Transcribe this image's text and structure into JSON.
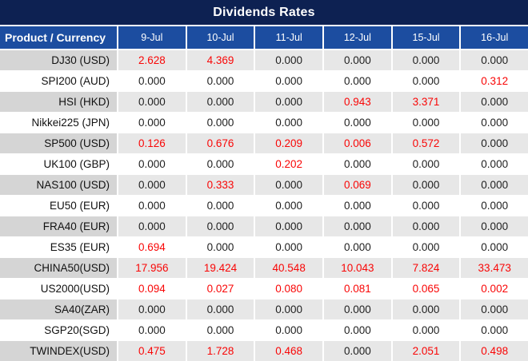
{
  "colors": {
    "title_bar_bg": "#0D2152",
    "header_bg": "#1C4DA0",
    "row_alt_label_bg": "#D5D5D5",
    "row_alt_value_bg": "#E7E7E7",
    "row_bg": "#FFFFFF",
    "highlight_value": "#F90606",
    "normal_value": "#1F1F1F",
    "header_text": "#FFFFFF"
  },
  "chart_data": {
    "type": "table",
    "title": "Dividends Rates",
    "corner_label": "Product / Currency",
    "columns": [
      "9-Jul",
      "10-Jul",
      "11-Jul",
      "12-Jul",
      "15-Jul",
      "16-Jul"
    ],
    "rows": [
      {
        "product": "DJ30 (USD)",
        "values": [
          "2.628",
          "4.369",
          "0.000",
          "0.000",
          "0.000",
          "0.000"
        ]
      },
      {
        "product": "SPI200 (AUD)",
        "values": [
          "0.000",
          "0.000",
          "0.000",
          "0.000",
          "0.000",
          "0.312"
        ]
      },
      {
        "product": "HSI (HKD)",
        "values": [
          "0.000",
          "0.000",
          "0.000",
          "0.943",
          "3.371",
          "0.000"
        ]
      },
      {
        "product": "Nikkei225 (JPN)",
        "values": [
          "0.000",
          "0.000",
          "0.000",
          "0.000",
          "0.000",
          "0.000"
        ]
      },
      {
        "product": "SP500 (USD)",
        "values": [
          "0.126",
          "0.676",
          "0.209",
          "0.006",
          "0.572",
          "0.000"
        ]
      },
      {
        "product": "UK100 (GBP)",
        "values": [
          "0.000",
          "0.000",
          "0.202",
          "0.000",
          "0.000",
          "0.000"
        ]
      },
      {
        "product": "NAS100 (USD)",
        "values": [
          "0.000",
          "0.333",
          "0.000",
          "0.069",
          "0.000",
          "0.000"
        ]
      },
      {
        "product": "EU50 (EUR)",
        "values": [
          "0.000",
          "0.000",
          "0.000",
          "0.000",
          "0.000",
          "0.000"
        ]
      },
      {
        "product": "FRA40 (EUR)",
        "values": [
          "0.000",
          "0.000",
          "0.000",
          "0.000",
          "0.000",
          "0.000"
        ]
      },
      {
        "product": "ES35 (EUR)",
        "values": [
          "0.694",
          "0.000",
          "0.000",
          "0.000",
          "0.000",
          "0.000"
        ]
      },
      {
        "product": "CHINA50(USD)",
        "values": [
          "17.956",
          "19.424",
          "40.548",
          "10.043",
          "7.824",
          "33.473"
        ]
      },
      {
        "product": "US2000(USD)",
        "values": [
          "0.094",
          "0.027",
          "0.080",
          "0.081",
          "0.065",
          "0.002"
        ]
      },
      {
        "product": "SA40(ZAR)",
        "values": [
          "0.000",
          "0.000",
          "0.000",
          "0.000",
          "0.000",
          "0.000"
        ]
      },
      {
        "product": "SGP20(SGD)",
        "values": [
          "0.000",
          "0.000",
          "0.000",
          "0.000",
          "0.000",
          "0.000"
        ]
      },
      {
        "product": "TWINDEX(USD)",
        "values": [
          "0.475",
          "1.728",
          "0.468",
          "0.000",
          "2.051",
          "0.498"
        ]
      }
    ],
    "highlight_rule": "non-zero values are shown in red",
    "layout_hints": {
      "alternating_rows": true,
      "label_column_align": "right",
      "value_align": "center"
    }
  }
}
